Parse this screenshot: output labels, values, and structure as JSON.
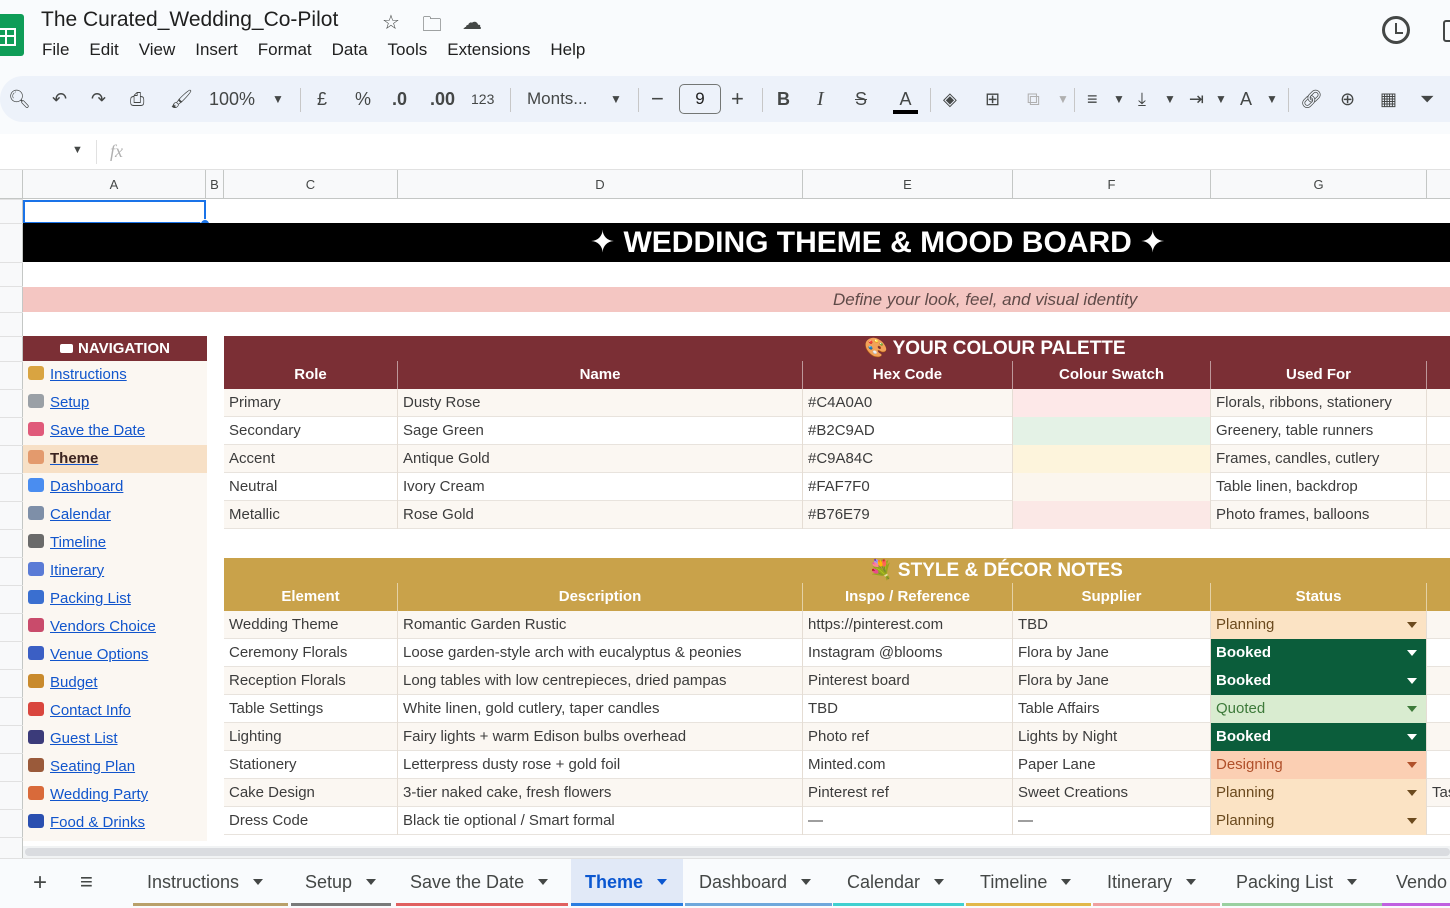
{
  "app": {
    "doc_title": "The Curated_Wedding_Co-Pilot",
    "menu": [
      "File",
      "Edit",
      "View",
      "Insert",
      "Format",
      "Data",
      "Tools",
      "Extensions",
      "Help"
    ]
  },
  "toolbar": {
    "zoom": "100%",
    "currency": "£",
    "percent": "%",
    "dec_less": ".0",
    "dec_more": ".00",
    "number_format": "123",
    "font": "Monts...",
    "font_size": "9",
    "minus": "−",
    "plus": "+",
    "bold": "B",
    "italic": "I",
    "strike": "S",
    "text_color": "A"
  },
  "formula_bar": {
    "fx": "fx",
    "name_box": ""
  },
  "columns": [
    "A",
    "B",
    "C",
    "D",
    "E",
    "F",
    "G"
  ],
  "sheet": {
    "banner": "✦  WEDDING THEME & MOOD BOARD  ✦",
    "subtitle": "Define your look, feel, and visual identity",
    "navigation": {
      "header": "NAVIGATION",
      "items": [
        {
          "label": "Instructions",
          "icon": "clipboard-icon",
          "color": "#d9a441"
        },
        {
          "label": "Setup",
          "icon": "gear-icon",
          "color": "#9aa0a6"
        },
        {
          "label": "Save the Date",
          "icon": "heart-letter-icon",
          "color": "#e05a7a"
        },
        {
          "label": "Theme",
          "icon": "palette-icon",
          "color": "#e39a6d",
          "active": true
        },
        {
          "label": "Dashboard",
          "icon": "bar-chart-icon",
          "color": "#4a8df0"
        },
        {
          "label": "Calendar",
          "icon": "calendar-icon",
          "color": "#7e8fa8"
        },
        {
          "label": "Timeline",
          "icon": "stopwatch-icon",
          "color": "#6a6a6a"
        },
        {
          "label": "Itinerary",
          "icon": "pager-icon",
          "color": "#5a7bd6"
        },
        {
          "label": "Packing List",
          "icon": "luggage-icon",
          "color": "#3a6fd0"
        },
        {
          "label": "Vendors Choice",
          "icon": "shop-icon",
          "color": "#c94b6b"
        },
        {
          "label": "Venue Options",
          "icon": "stadium-icon",
          "color": "#3b5fc4"
        },
        {
          "label": "Budget",
          "icon": "money-bag-icon",
          "color": "#c98a2c"
        },
        {
          "label": "Contact Info",
          "icon": "phone-icon",
          "color": "#d9463e"
        },
        {
          "label": "Guest List",
          "icon": "people-icon",
          "color": "#3b3b7a"
        },
        {
          "label": "Seating Plan",
          "icon": "chair-icon",
          "color": "#9a5a3a"
        },
        {
          "label": "Wedding Party",
          "icon": "party-icon",
          "color": "#d96a3a"
        },
        {
          "label": "Food & Drinks",
          "icon": "plate-icon",
          "color": "#2a4fb0"
        }
      ]
    },
    "palette": {
      "title": "🎨  YOUR COLOUR PALETTE",
      "headers": [
        "Role",
        "Name",
        "Hex Code",
        "Colour Swatch",
        "Used For"
      ],
      "rows": [
        {
          "role": "Primary",
          "name": "Dusty Rose",
          "hex": "#C4A0A0",
          "swatch": "#fde8e8",
          "used": "Florals, ribbons, stationery"
        },
        {
          "role": "Secondary",
          "name": "Sage Green",
          "hex": "#B2C9AD",
          "swatch": "#e4f2e6",
          "used": "Greenery, table runners"
        },
        {
          "role": "Accent",
          "name": "Antique Gold",
          "hex": "#C9A84C",
          "swatch": "#fdf4dc",
          "used": "Frames, candles, cutlery"
        },
        {
          "role": "Neutral",
          "name": "Ivory Cream",
          "hex": "#FAF7F0",
          "swatch": "#fbf6ee",
          "used": "Table linen, backdrop"
        },
        {
          "role": "Metallic",
          "name": "Rose Gold",
          "hex": "#B76E79",
          "swatch": "#fbe8e6",
          "used": "Photo frames, balloons"
        }
      ]
    },
    "decor": {
      "title": "💐  STYLE & DÉCOR NOTES",
      "headers": [
        "Element",
        "Description",
        "Inspo / Reference",
        "Supplier",
        "Status"
      ],
      "rows": [
        {
          "element": "Wedding Theme",
          "description": "Romantic Garden Rustic",
          "inspo": "https://pinterest.com",
          "supplier": "TBD",
          "status": "Planning"
        },
        {
          "element": "Ceremony Florals",
          "description": "Loose garden-style arch with eucalyptus & peonies",
          "inspo": "Instagram @blooms",
          "supplier": "Flora by Jane",
          "status": "Booked"
        },
        {
          "element": "Reception Florals",
          "description": "Long tables with low centrepieces, dried pampas",
          "inspo": "Pinterest board",
          "supplier": "Flora by Jane",
          "status": "Booked"
        },
        {
          "element": "Table Settings",
          "description": "White linen, gold cutlery, taper candles",
          "inspo": "TBD",
          "supplier": "Table Affairs",
          "status": "Quoted"
        },
        {
          "element": "Lighting",
          "description": "Fairy lights + warm Edison bulbs overhead",
          "inspo": "Photo ref",
          "supplier": "Lights by Night",
          "status": "Booked"
        },
        {
          "element": "Stationery",
          "description": "Letterpress dusty rose + gold foil",
          "inspo": "Minted.com",
          "supplier": "Paper Lane",
          "status": "Designing"
        },
        {
          "element": "Cake Design",
          "description": "3-tier naked cake, fresh flowers",
          "inspo": "Pinterest ref",
          "supplier": "Sweet Creations",
          "status": "Planning",
          "overflow": "Tas"
        },
        {
          "element": "Dress Code",
          "description": "Black tie optional / Smart formal",
          "inspo": "—",
          "supplier": "—",
          "status": "Planning"
        }
      ]
    }
  },
  "status_styles": {
    "Planning": {
      "bg": "#fbe3c4",
      "fg": "#6b4a1e"
    },
    "Booked": {
      "bg": "#0b5d3b",
      "fg": "#ffffff"
    },
    "Quoted": {
      "bg": "#d9ecd0",
      "fg": "#3d7a3a"
    },
    "Designing": {
      "bg": "#fbcfb3",
      "fg": "#b0502a"
    }
  },
  "colors": {
    "palette_header": "#7b2f35",
    "decor_header": "#c9a24a",
    "row_odd": "#fbf7f2",
    "row_even": "#ffffff"
  },
  "tabs": [
    {
      "label": "Instructions",
      "color": "#b9a06a"
    },
    {
      "label": "Setup",
      "color": "#7a7a7a"
    },
    {
      "label": "Save the Date",
      "color": "#e06060"
    },
    {
      "label": "Theme",
      "color": "#2a7de1",
      "active": true
    },
    {
      "label": "Dashboard",
      "color": "#6fa8dc"
    },
    {
      "label": "Calendar",
      "color": "#40d0d0"
    },
    {
      "label": "Timeline",
      "color": "#e2b84a"
    },
    {
      "label": "Itinerary",
      "color": "#f0a0a0"
    },
    {
      "label": "Packing List",
      "color": "#9ad0a0"
    },
    {
      "label": "Vendo",
      "color": "#c060e0"
    }
  ]
}
